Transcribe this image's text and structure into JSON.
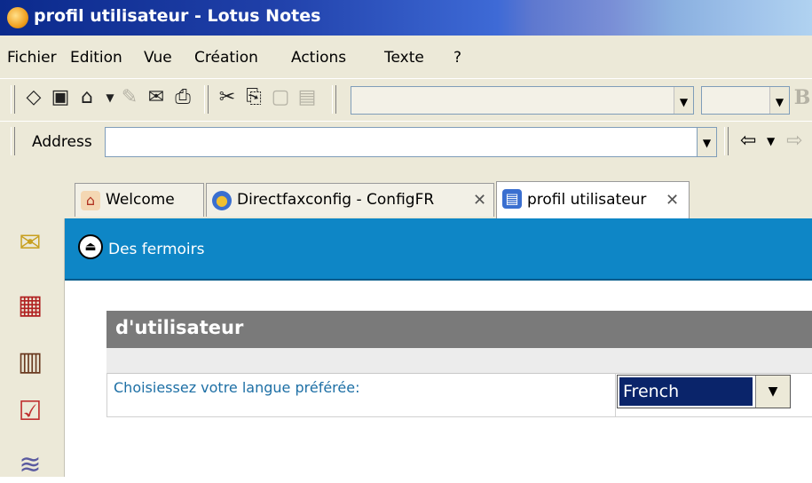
{
  "window": {
    "title": "profil utilisateur - Lotus Notes"
  },
  "menu": [
    {
      "label": "Fichier"
    },
    {
      "label": "Edition"
    },
    {
      "label": "Vue"
    },
    {
      "label": "Création"
    },
    {
      "label": "Actions"
    },
    {
      "label": "Texte"
    },
    {
      "label": "?"
    }
  ],
  "toolbar2": {
    "address_label": "Address",
    "address_value": ""
  },
  "tabs": [
    {
      "label": "Welcome",
      "icon": "home-icon"
    },
    {
      "label": "Directfaxconfig - ConfigFR",
      "icon": "database-icon"
    },
    {
      "label": "profil utilisateur",
      "icon": "profile-document-icon"
    }
  ],
  "action_bar": {
    "label": "Des fermoirs"
  },
  "form": {
    "section_title": "d'utilisateur",
    "field_label": "Choisiessez votre langue préférée:",
    "language_value": "French"
  },
  "colors": {
    "action_bar": "#0e86c6",
    "section_header": "#7a7a7a",
    "field_label": "#1d6fa5",
    "selection": "#0a246a"
  }
}
